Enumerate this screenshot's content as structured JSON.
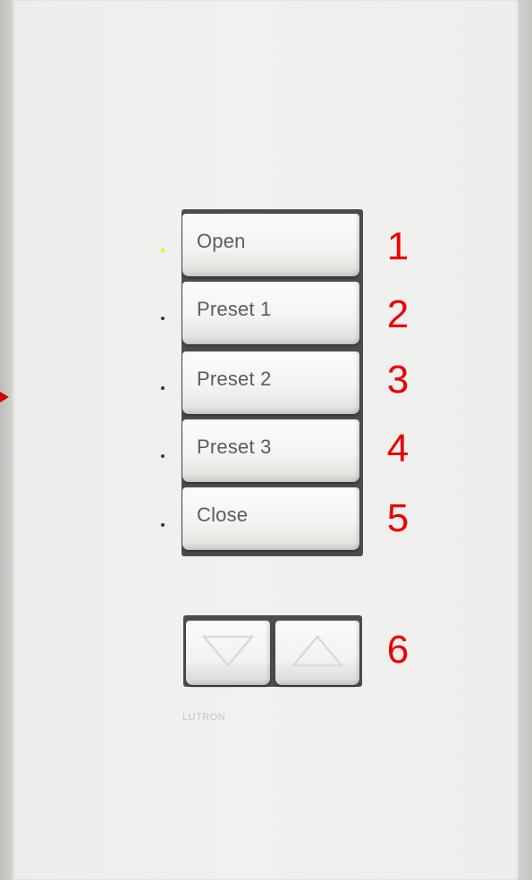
{
  "keypad": {
    "brand": "LUTRON",
    "buttons": [
      {
        "label": "Open",
        "callout": "1",
        "led_on": true
      },
      {
        "label": "Preset 1",
        "callout": "2",
        "led_on": false
      },
      {
        "label": "Preset 2",
        "callout": "3",
        "led_on": false
      },
      {
        "label": "Preset 3",
        "callout": "4",
        "led_on": false
      },
      {
        "label": "Close",
        "callout": "5",
        "led_on": false
      }
    ],
    "raise_lower": {
      "callout": "6",
      "lower_icon": "triangle-down-icon",
      "raise_icon": "triangle-up-icon"
    }
  },
  "colors": {
    "callout": "#ec0000",
    "led_active": "#e8ef2a",
    "faceplate": "#f0f0ef"
  }
}
